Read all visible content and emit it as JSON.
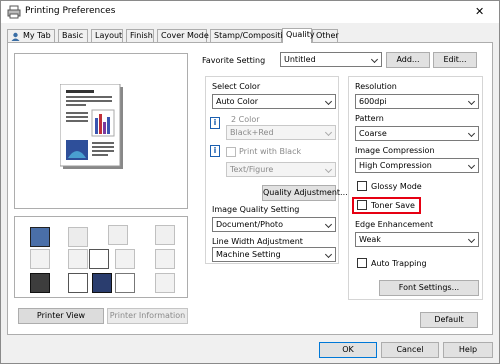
{
  "window": {
    "title": "Printing Preferences",
    "close_glyph": "✕"
  },
  "tabs": [
    "My Tab",
    "Basic",
    "Layout",
    "Finish",
    "Cover Mode",
    "Stamp/Composition",
    "Quality",
    "Other"
  ],
  "favorite": {
    "label": "Favorite Setting",
    "value": "Untitled",
    "add": "Add...",
    "edit": "Edit..."
  },
  "left": {
    "printer_view": "Printer View",
    "printer_info": "Printer Information"
  },
  "select_color": {
    "label": "Select Color",
    "value": "Auto Color"
  },
  "two_color": {
    "label": "2 Color",
    "value": "Black+Red"
  },
  "print_black": {
    "label": "Print with Black",
    "value": "Text/Figure"
  },
  "quality_adjustment": "Quality Adjustment...",
  "iqs": {
    "label": "Image Quality Setting",
    "value": "Document/Photo"
  },
  "lwa": {
    "label": "Line Width Adjustment",
    "value": "Machine Setting"
  },
  "resolution": {
    "label": "Resolution",
    "value": "600dpi"
  },
  "pattern": {
    "label": "Pattern",
    "value": "Coarse"
  },
  "compression": {
    "label": "Image Compression",
    "value": "High Compression"
  },
  "glossy": "Glossy Mode",
  "toner": "Toner Save",
  "edge": {
    "label": "Edge Enhancement",
    "value": "Weak"
  },
  "trapping": "Auto Trapping",
  "font_settings": "Font Settings...",
  "default_btn": "Default",
  "bottom": {
    "ok": "OK",
    "cancel": "Cancel",
    "help": "Help"
  },
  "colors": {
    "highlight": "#e60012",
    "accent": "#0078d7"
  }
}
